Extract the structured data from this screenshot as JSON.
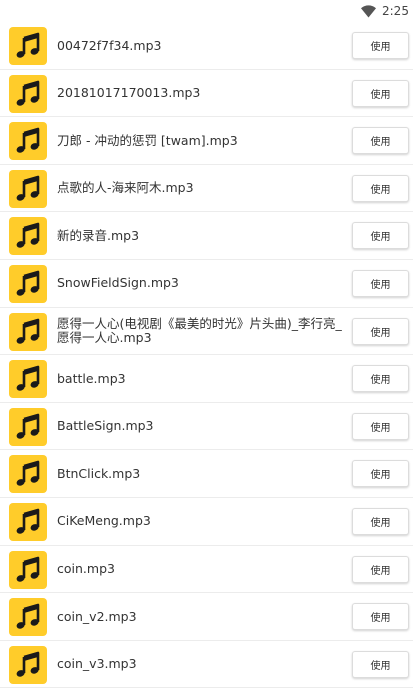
{
  "status_bar": {
    "time": "2:25",
    "wifi_icon": "wifi-icon"
  },
  "theme": {
    "tile_color": "#ffcc2a",
    "note_color": "#1a1a1a"
  },
  "files": [
    {
      "name": "00472f7f34.mp3",
      "action": "使用",
      "icon": "music-note-icon"
    },
    {
      "name": "20181017170013.mp3",
      "action": "使用",
      "icon": "music-note-icon"
    },
    {
      "name": "刀郎 - 冲动的惩罚 [twam].mp3",
      "action": "使用",
      "icon": "music-note-icon"
    },
    {
      "name": "点歌的人-海来阿木.mp3",
      "action": "使用",
      "icon": "music-note-icon"
    },
    {
      "name": "新的录音.mp3",
      "action": "使用",
      "icon": "music-note-icon"
    },
    {
      "name": "SnowFieldSign.mp3",
      "action": "使用",
      "icon": "music-note-icon"
    },
    {
      "name": "愿得一人心(电视剧《最美的时光》片头曲)_李行亮_愿得一人心.mp3",
      "action": "使用",
      "icon": "music-note-icon"
    },
    {
      "name": "battle.mp3",
      "action": "使用",
      "icon": "music-note-icon"
    },
    {
      "name": "BattleSign.mp3",
      "action": "使用",
      "icon": "music-note-icon"
    },
    {
      "name": "BtnClick.mp3",
      "action": "使用",
      "icon": "music-note-icon"
    },
    {
      "name": "CiKeMeng.mp3",
      "action": "使用",
      "icon": "music-note-icon"
    },
    {
      "name": "coin.mp3",
      "action": "使用",
      "icon": "music-note-icon"
    },
    {
      "name": "coin_v2.mp3",
      "action": "使用",
      "icon": "music-note-icon"
    },
    {
      "name": "coin_v3.mp3",
      "action": "使用",
      "icon": "music-note-icon"
    }
  ]
}
